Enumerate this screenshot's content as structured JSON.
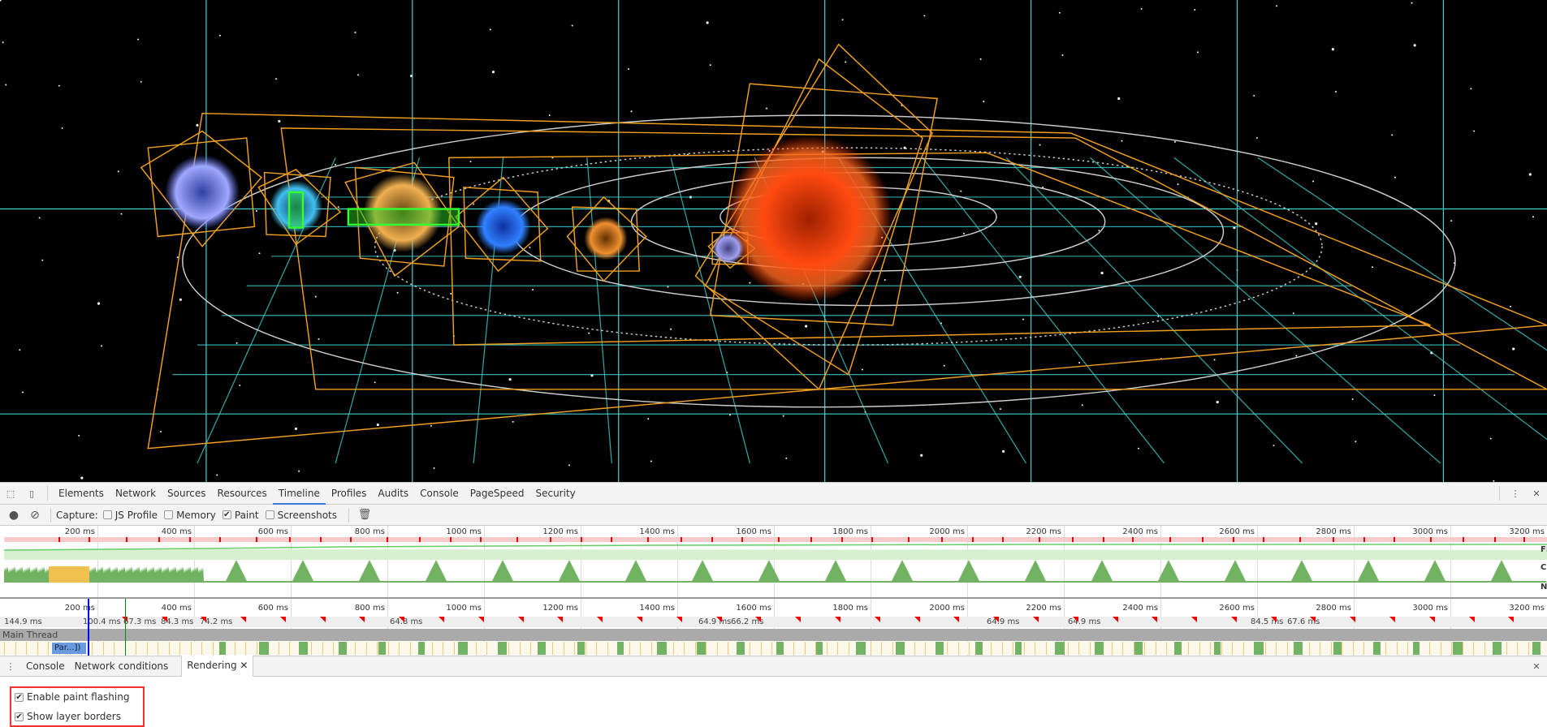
{
  "devtools": {
    "tabs": [
      "Elements",
      "Network",
      "Sources",
      "Resources",
      "Timeline",
      "Profiles",
      "Audits",
      "Console",
      "PageSpeed",
      "Security"
    ],
    "active_tab": "Timeline"
  },
  "toolbar": {
    "capture_label": "Capture:",
    "options": [
      {
        "label": "JS Profile",
        "checked": false
      },
      {
        "label": "Memory",
        "checked": false
      },
      {
        "label": "Paint",
        "checked": true
      },
      {
        "label": "Screenshots",
        "checked": false
      }
    ]
  },
  "overview": {
    "ticks": [
      "200 ms",
      "400 ms",
      "600 ms",
      "800 ms",
      "1000 ms",
      "1200 ms",
      "1400 ms",
      "1600 ms",
      "1800 ms",
      "2000 ms",
      "2200 ms",
      "2400 ms",
      "2600 ms",
      "2800 ms",
      "3000 ms",
      "3200 ms"
    ],
    "track_labels": [
      "FPS",
      "CPU",
      "NET"
    ]
  },
  "details": {
    "ticks": [
      "200 ms",
      "400 ms",
      "600 ms",
      "800 ms",
      "1000 ms",
      "1200 ms",
      "1400 ms",
      "1600 ms",
      "1800 ms",
      "2000 ms",
      "2200 ms",
      "2400 ms",
      "2600 ms",
      "2800 ms",
      "3000 ms",
      "3200 ms"
    ],
    "frames": [
      "144.9 ms",
      "100.4 ms",
      "67.3 ms",
      "84.3 ms",
      "74.2 ms",
      "64.8 ms",
      "64.9 ms",
      "66.2 ms",
      "64.9 ms",
      "64.9 ms",
      "84.5 ms",
      "67.6 ms"
    ],
    "main_thread_label": "Main Thread",
    "flame_label": "Par...])"
  },
  "drawer": {
    "tabs": [
      "Console",
      "Network conditions",
      "Rendering"
    ],
    "active": "Rendering",
    "options": [
      {
        "label": "Enable paint flashing",
        "checked": true
      },
      {
        "label": "Show layer borders",
        "checked": true
      }
    ]
  },
  "colors": {
    "accent": "#3879d9",
    "layer_border": "#f0a020",
    "grid": "#3fd0d0",
    "scripting": "#f0c050",
    "rendering": "#9b7fe6",
    "painting": "#71b363",
    "highlight": "#e33"
  }
}
